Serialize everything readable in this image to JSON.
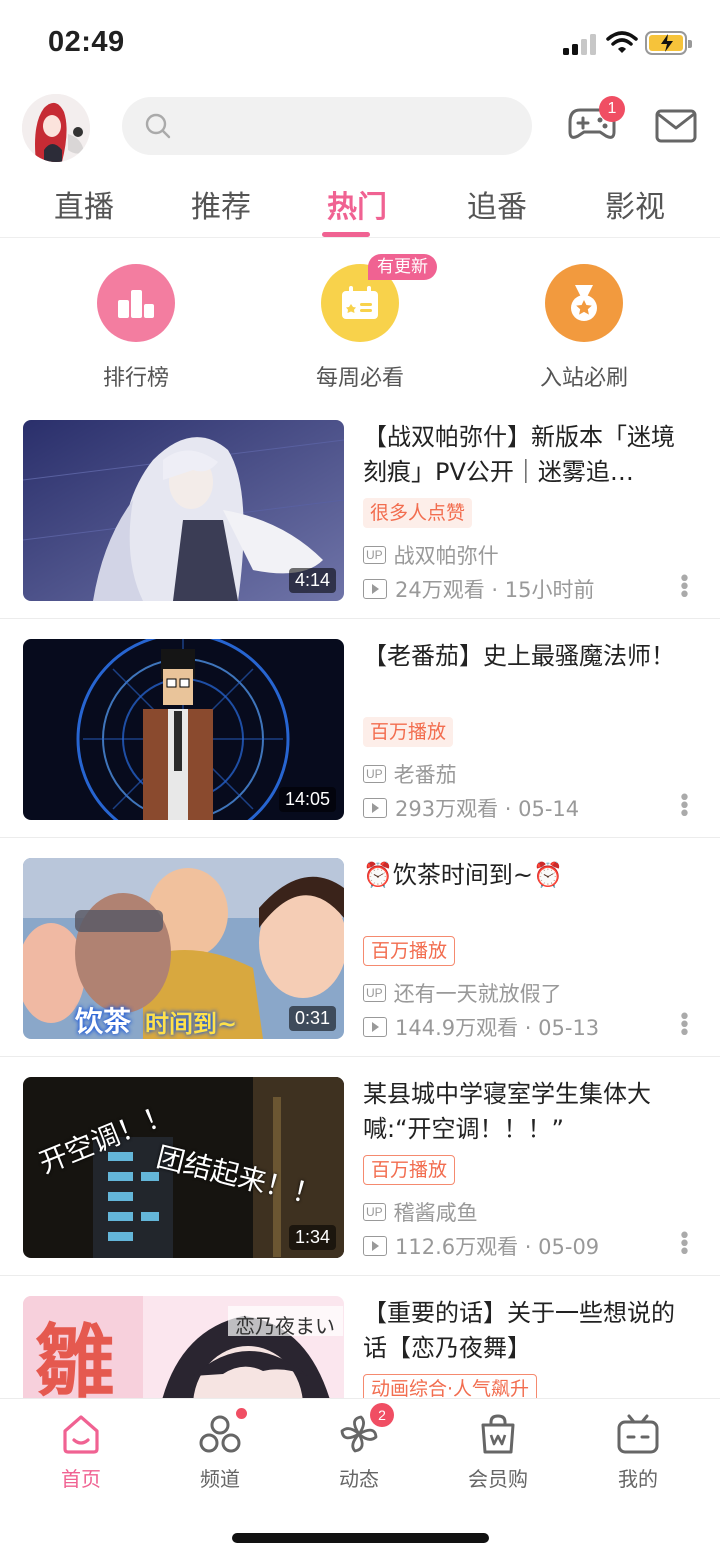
{
  "status_bar": {
    "time": "02:49"
  },
  "header": {
    "notification_count": "1"
  },
  "tabs": [
    {
      "label": "直播"
    },
    {
      "label": "推荐"
    },
    {
      "label": "热门",
      "active": true
    },
    {
      "label": "追番"
    },
    {
      "label": "影视"
    }
  ],
  "quick_links": [
    {
      "label": "排行榜",
      "icon": "podium-icon",
      "color": "#f37da0"
    },
    {
      "label": "每周必看",
      "icon": "calendar-icon",
      "color": "#f8d24b",
      "badge": "有更新"
    },
    {
      "label": "入站必刷",
      "icon": "medal-icon",
      "color": "#f29a3e"
    }
  ],
  "videos": [
    {
      "title": "【战双帕弥什】新版本「迷境刻痕」PV公开｜迷雾追…",
      "tag": "很多人点赞",
      "tag_style": "fill",
      "uploader": "战双帕弥什",
      "views": "24万观看 · 15小时前",
      "duration": "4:14"
    },
    {
      "title": "【老番茄】史上最骚魔法师！",
      "tag": "百万播放",
      "tag_style": "fill",
      "uploader": "老番茄",
      "views": "293万观看 · 05-14",
      "duration": "14:05"
    },
    {
      "title": "⏰饮茶时间到~⏰",
      "tag": "百万播放",
      "tag_style": "line",
      "uploader": "还有一天就放假了",
      "views": "144.9万观看 · 05-13",
      "duration": "0:31",
      "thumb_caption_a": "饮茶",
      "thumb_caption_b": "时间到~"
    },
    {
      "title": "某县城中学寝室学生集体大喊:“开空调！！！”",
      "tag": "百万播放",
      "tag_style": "line",
      "uploader": "稽酱咸鱼",
      "views": "112.6万观看 · 05-09",
      "duration": "1:34",
      "thumb_caption_a": "开空调！！",
      "thumb_caption_b": "团结起来！！"
    },
    {
      "title": "【重要的话】关于一些想说的话【恋乃夜舞】",
      "tag": "动画综合·人气飙升",
      "tag_style": "line",
      "thumb_caption_a": "雛",
      "thumb_caption_b": "恋乃夜まい"
    }
  ],
  "up_label": "UP",
  "bottom_nav": [
    {
      "label": "首页",
      "icon": "home-icon",
      "active": true
    },
    {
      "label": "频道",
      "icon": "channel-icon",
      "dot": true
    },
    {
      "label": "动态",
      "icon": "pinwheel-icon",
      "badge": "2"
    },
    {
      "label": "会员购",
      "icon": "shopping-bag-icon"
    },
    {
      "label": "我的",
      "icon": "tv-icon"
    }
  ],
  "colors": {
    "accent": "#f06292",
    "tag": "#f26d4f",
    "badge": "#f04e63"
  }
}
